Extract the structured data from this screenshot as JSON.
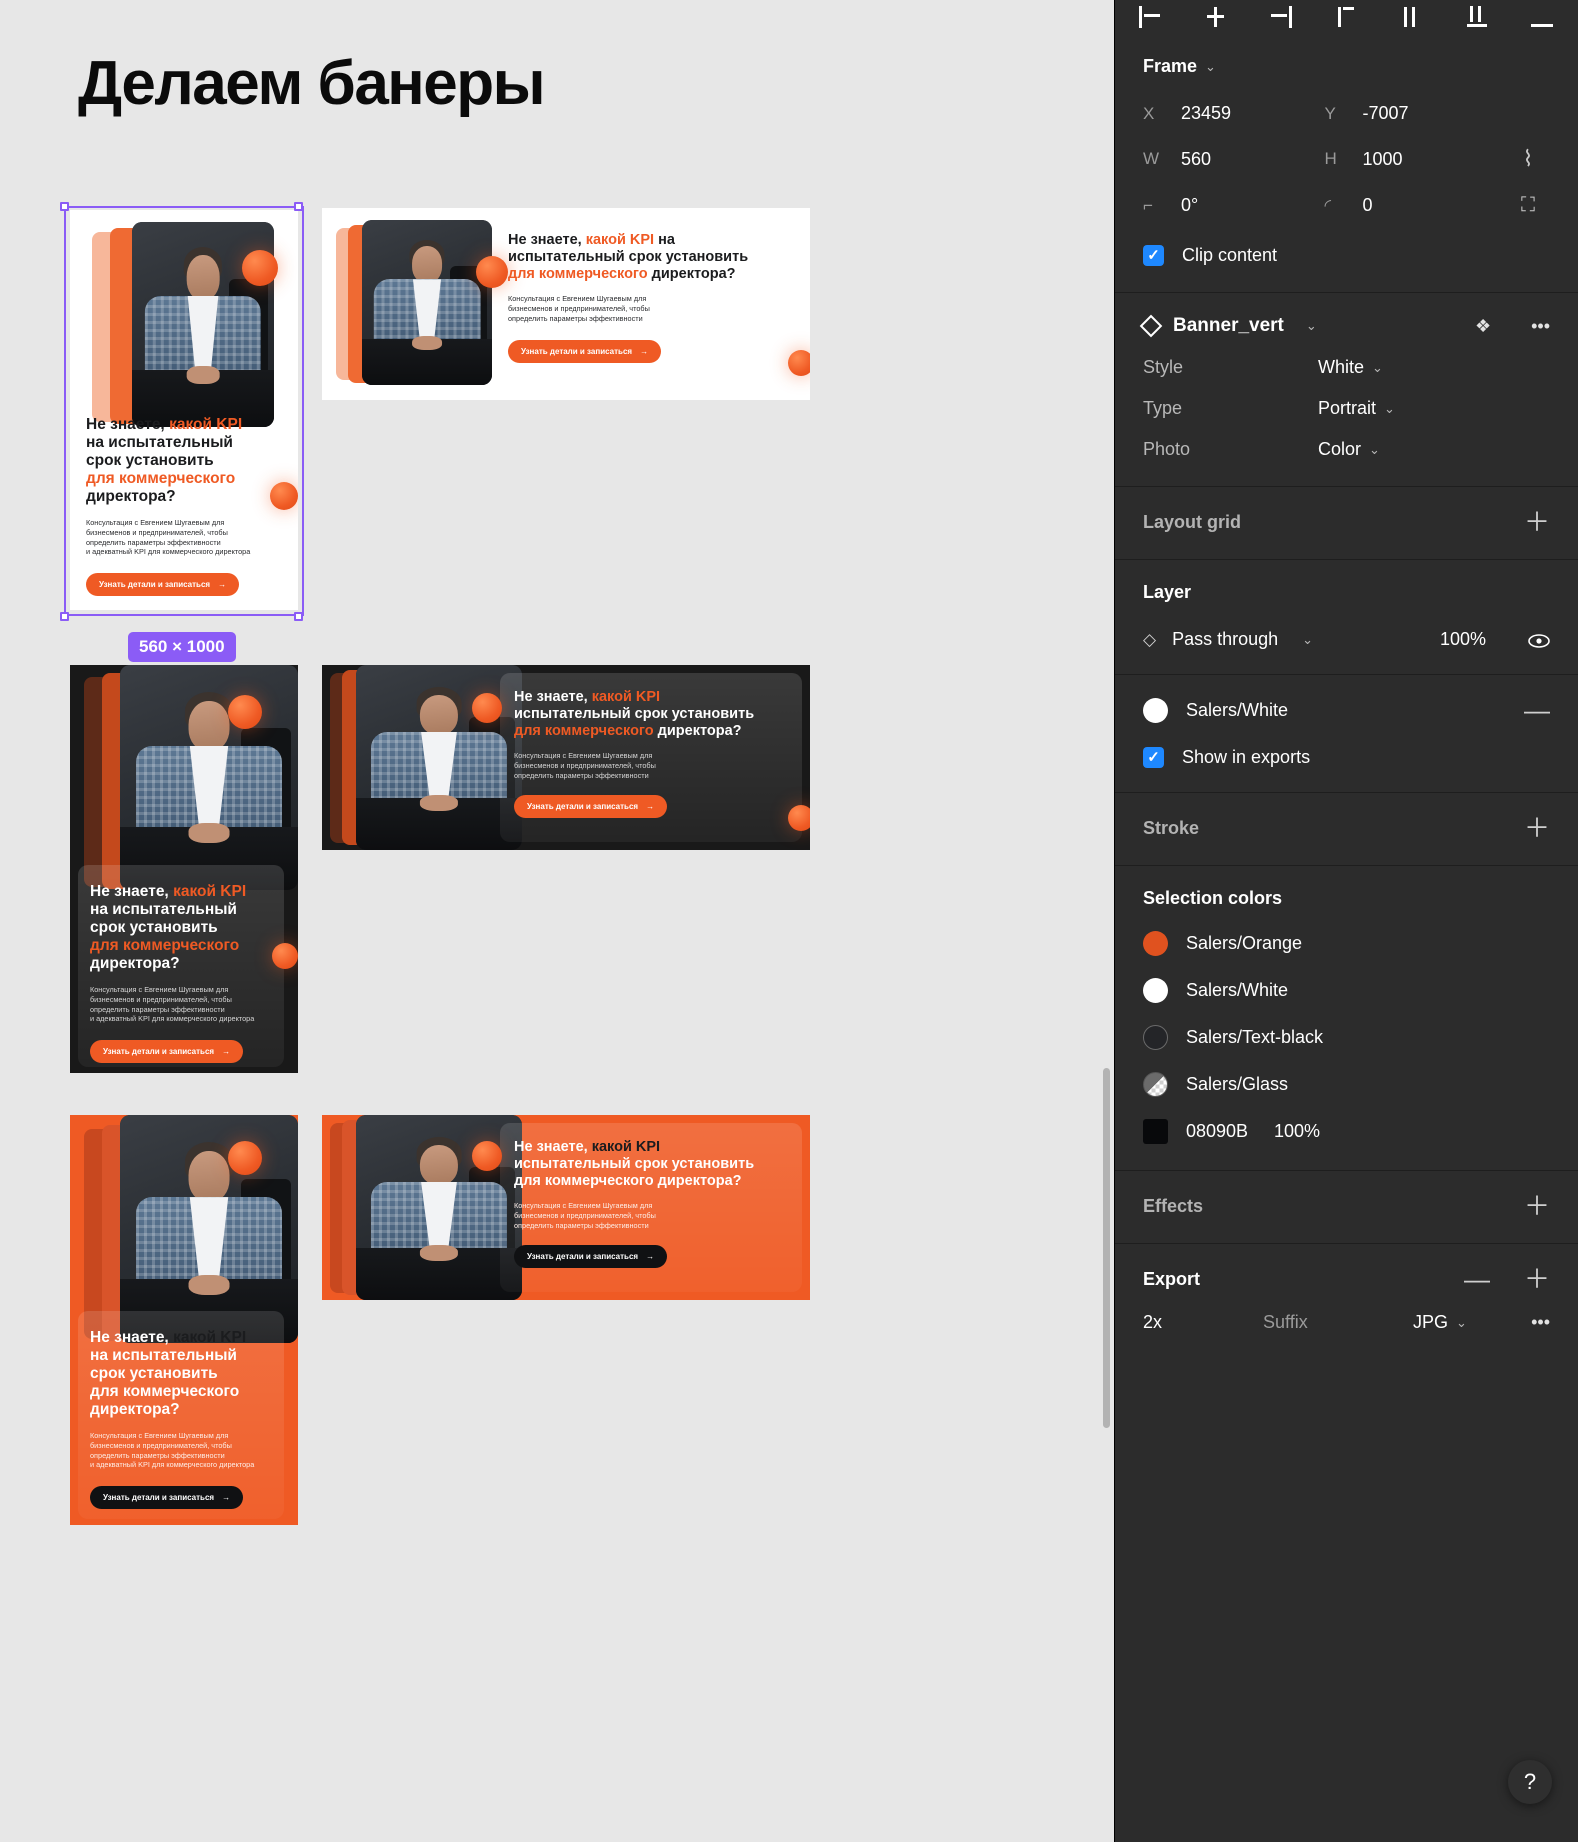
{
  "canvas": {
    "title": "Делаем банеры",
    "size_badge": "560 × 1000"
  },
  "banner_content": {
    "head_line1_a": "Не знаете, ",
    "head_line1_b": "какой KPI",
    "head_line2": "на испытательный",
    "head_line3": "срок установить",
    "head_line4_hl": "для коммерческого",
    "head_line5": "директора?",
    "head_h_line1_a": "Не знаете, ",
    "head_h_line1_b": "какой KPI",
    "head_h_line1_c": " на",
    "head_h_line2": "испытательный срок установить",
    "head_h_line3_hl": "для коммерческого",
    "head_h_line3_c": " директора?",
    "sub_line1": "Консультация с Евгением Шугаевым для",
    "sub_line2": "бизнесменов и предпринимателей, чтобы",
    "sub_line3": "определить параметры эффективности",
    "sub_line4": "и адекватный KPI  для коммерческого директора",
    "cta": "Узнать детали и записаться",
    "cta_arrow": "→"
  },
  "panel": {
    "align_icons": [
      "align-left-icon",
      "align-horizontal-center-icon",
      "align-right-icon",
      "align-top-icon",
      "align-vertical-center-icon",
      "align-bottom-icon",
      "distribute-icon"
    ],
    "frame": {
      "title": "Frame",
      "x_label": "X",
      "x_value": "23459",
      "y_label": "Y",
      "y_value": "-7007",
      "w_label": "W",
      "w_value": "560",
      "h_label": "H",
      "h_value": "1000",
      "rotation_value": "0°",
      "corner_value": "0",
      "clip_content_label": "Clip content"
    },
    "component": {
      "name": "Banner_vert",
      "props": [
        {
          "key": "Style",
          "value": "White"
        },
        {
          "key": "Type",
          "value": "Portrait"
        },
        {
          "key": "Photo",
          "value": "Color"
        }
      ]
    },
    "layout_grid": {
      "title": "Layout grid"
    },
    "layer": {
      "title": "Layer",
      "blend_mode": "Pass through",
      "opacity": "100%"
    },
    "fill": {
      "name": "Salers/White",
      "show_in_exports": "Show in exports"
    },
    "stroke": {
      "title": "Stroke"
    },
    "selection_colors": {
      "title": "Selection colors",
      "items": [
        {
          "name": "Salers/Orange",
          "color": "#e0521f",
          "kind": "solid"
        },
        {
          "name": "Salers/White",
          "color": "#ffffff",
          "kind": "solid"
        },
        {
          "name": "Salers/Text-black",
          "color": "#242528",
          "kind": "ring"
        },
        {
          "name": "Salers/Glass",
          "color": "#6b6b6b",
          "kind": "glass"
        },
        {
          "name": "08090B",
          "color": "#08090b",
          "kind": "square",
          "pct": "100%"
        }
      ]
    },
    "effects": {
      "title": "Effects"
    },
    "export": {
      "title": "Export",
      "scale": "2x",
      "suffix": "Suffix",
      "format": "JPG"
    },
    "help": "?"
  }
}
